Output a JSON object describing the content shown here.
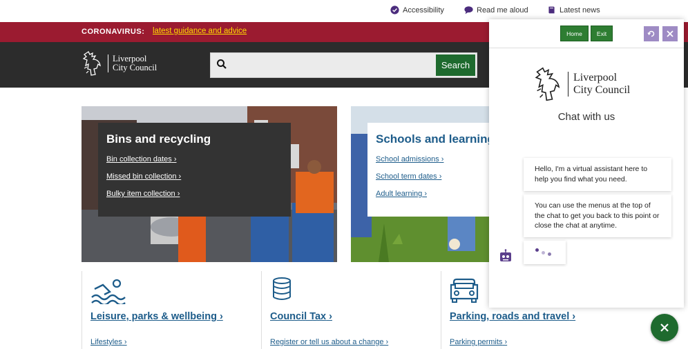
{
  "utility": {
    "accessibility": "Accessibility",
    "read_aloud": "Read me aloud",
    "latest_news": "Latest news"
  },
  "corona": {
    "label": "CORONAVIRUS:",
    "link": "latest guidance and advice"
  },
  "header": {
    "logo_line1": "Liverpool",
    "logo_line2": "City Council",
    "search_placeholder": "",
    "search_button": "Search"
  },
  "features": {
    "bins": {
      "title": "Bins and recycling",
      "links": [
        "Bin collection dates",
        "Missed bin collection",
        "Bulky item collection"
      ]
    },
    "schools": {
      "title": "Schools and learning",
      "links": [
        "School admissions",
        "School term dates",
        "Adult learning"
      ]
    }
  },
  "tiles": [
    {
      "icon": "swimmer-icon",
      "title": "Leisure, parks & wellbeing",
      "link": "Lifestyles"
    },
    {
      "icon": "coins-icon",
      "title": "Council Tax",
      "link": "Register or tell us about a change"
    },
    {
      "icon": "car-icon",
      "title": "Parking, roads and travel",
      "link": "Parking permits"
    }
  ],
  "chat": {
    "home_button": "Home",
    "exit_button": "Exit",
    "logo_line1": "Liverpool",
    "logo_line2": "City Council",
    "heading": "Chat with us",
    "messages": [
      "Hello, I'm a virtual assistant here to help you find what you need.",
      "You can use the menus at the top of the chat to get you back to this point or close the chat at anytime."
    ]
  },
  "colors": {
    "corona_bg": "#9b1b30",
    "corona_link": "#ffdd00",
    "header_bg": "#2c2c2c",
    "accent_green": "#1e6a2e",
    "link_blue": "#1d5c8a",
    "chat_purple": "#9e8bc4"
  }
}
